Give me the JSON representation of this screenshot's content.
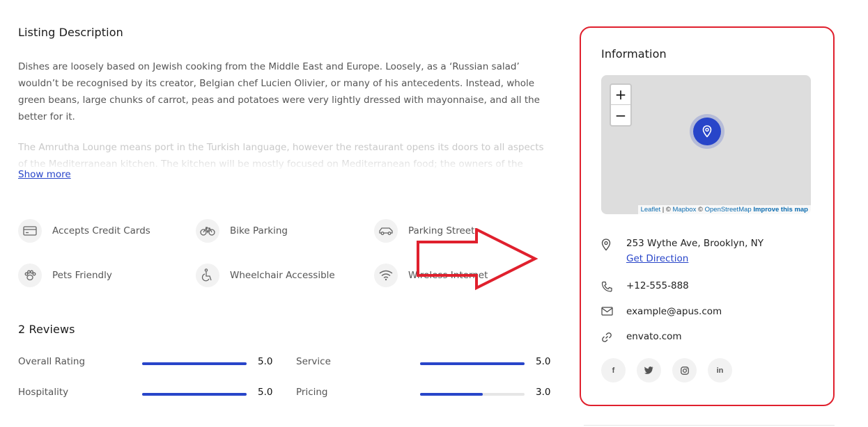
{
  "listing": {
    "title": "Listing Description",
    "para1": "Dishes are loosely based on Jewish cooking from the Middle East and Europe. Loosely, as a ‘Russian salad’ wouldn’t be recognised by its creator, Belgian chef Lucien Olivier, or many of his antecedents. Instead, whole green beans, large chunks of carrot, peas and potatoes were very lightly dressed with mayonnaise, and all the better for it.",
    "para2": "The Amrutha Lounge means port in the Turkish language, however the restaurant opens its doors to all aspects of the Mediterranean kitchen. The kitchen will be mostly focused on Mediterranean food; the owners of the restaurant are",
    "show_more": "Show more"
  },
  "amenities": [
    {
      "label": "Accepts Credit Cards",
      "icon": "credit-card-icon"
    },
    {
      "label": "Bike Parking",
      "icon": "bike-icon"
    },
    {
      "label": "Parking Street",
      "icon": "car-icon"
    },
    {
      "label": "Pets Friendly",
      "icon": "paw-icon"
    },
    {
      "label": "Wheelchair Accessible",
      "icon": "wheelchair-icon"
    },
    {
      "label": "Wireless Internet",
      "icon": "wifi-icon"
    }
  ],
  "reviews": {
    "title": "2 Reviews",
    "ratings": [
      {
        "label": "Overall Rating",
        "value": "5.0",
        "fraction": 1.0
      },
      {
        "label": "Service",
        "value": "5.0",
        "fraction": 1.0
      },
      {
        "label": "Hospitality",
        "value": "5.0",
        "fraction": 1.0
      },
      {
        "label": "Pricing",
        "value": "3.0",
        "fraction": 0.6
      }
    ]
  },
  "information": {
    "title": "Information",
    "map": {
      "zoom_in": "+",
      "zoom_out": "−",
      "attr_leaflet": "Leaflet",
      "attr_sep1": " | © ",
      "attr_mapbox": "Mapbox",
      "attr_sep2": " © ",
      "attr_osm": "OpenStreetMap",
      "attr_improve": "Improve this map"
    },
    "address": "253 Wythe Ave, Brooklyn, NY",
    "directions": "Get Direction",
    "phone": "+12-555-888",
    "email": "example@apus.com",
    "website": "envato.com",
    "socials": [
      {
        "label": "f",
        "icon": "facebook-icon"
      },
      {
        "label": "twitter",
        "icon": "twitter-icon"
      },
      {
        "label": "instagram",
        "icon": "instagram-icon"
      },
      {
        "label": "in",
        "icon": "linkedin-icon"
      }
    ]
  },
  "colors": {
    "accent": "#2845c9",
    "highlight_red": "#e0202d"
  }
}
